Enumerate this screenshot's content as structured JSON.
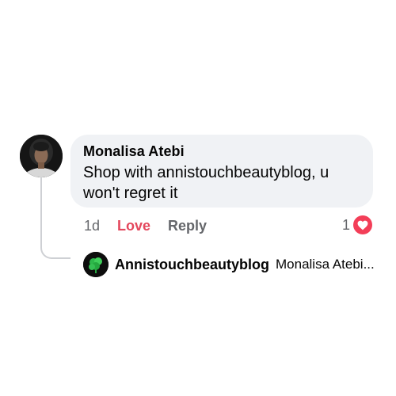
{
  "comment": {
    "author": "Monalisa Atebi",
    "text": "Shop with annistouchbeautyblog, u won't regret it",
    "time": "1d",
    "love_label": "Love",
    "reply_label": "Reply",
    "reaction_count": "1",
    "reaction_icon": "heart-icon",
    "love_color": "#e4485d"
  },
  "reply": {
    "author": "Annistouchbeautyblog",
    "preview": "Monalisa Atebi..."
  }
}
